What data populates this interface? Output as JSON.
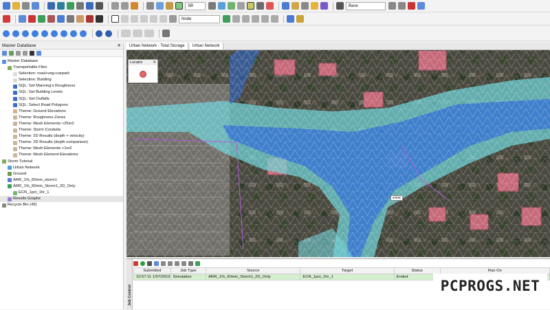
{
  "toolbar": {
    "combo_sb": "SB",
    "combo_base": "Base",
    "combo_node": "Node"
  },
  "left_panel": {
    "title": "Master Database",
    "tree": [
      {
        "label": "Master Database",
        "indent": 0,
        "icon": "database-icon"
      },
      {
        "label": "Transportable Files",
        "indent": 1,
        "icon": "group-icon"
      },
      {
        "label": "Selection: road+veg+carpark",
        "indent": 2,
        "icon": "selection-icon"
      },
      {
        "label": "Selection: Building",
        "indent": 2,
        "icon": "selection-icon"
      },
      {
        "label": "SQL: Set Manning's Roughness",
        "indent": 2,
        "icon": "sql-icon"
      },
      {
        "label": "SQL: Set Building Levels",
        "indent": 2,
        "icon": "sql-icon"
      },
      {
        "label": "SQL: Set Outfalls",
        "indent": 2,
        "icon": "sql-icon"
      },
      {
        "label": "SQL: Select Road Polygons",
        "indent": 2,
        "icon": "sql-icon"
      },
      {
        "label": "Theme: Ground Elevations",
        "indent": 2,
        "icon": "theme-icon"
      },
      {
        "label": "Theme: Roughness Zones",
        "indent": 2,
        "icon": "theme-icon"
      },
      {
        "label": "Theme: Mesh Elements <25m2",
        "indent": 2,
        "icon": "theme-icon"
      },
      {
        "label": "Theme: Storm Conduits",
        "indent": 2,
        "icon": "theme-icon"
      },
      {
        "label": "Theme: 2D Results (depth + velocity)",
        "indent": 2,
        "icon": "theme-icon"
      },
      {
        "label": "Theme: 2D Results (depth comparison)",
        "indent": 2,
        "icon": "theme-icon"
      },
      {
        "label": "Theme: Mesh Elements <1m2",
        "indent": 2,
        "icon": "theme-icon"
      },
      {
        "label": "Theme: Mesh Element Elevations",
        "indent": 2,
        "icon": "theme-icon"
      },
      {
        "label": "Storm Tutorial",
        "indent": 0,
        "icon": "group-icon"
      },
      {
        "label": "Urban Network",
        "indent": 1,
        "icon": "network-icon"
      },
      {
        "label": "Ground",
        "indent": 1,
        "icon": "ground-icon"
      },
      {
        "label": "ARR_1%_60min_storm1",
        "indent": 1,
        "icon": "rainfall-icon"
      },
      {
        "label": "ARR_1%_60min_Storm1_2D_Only",
        "indent": 1,
        "icon": "run-icon"
      },
      {
        "label": "ECN_1pct_1hr_1",
        "indent": 2,
        "icon": "simulation-icon"
      },
      {
        "label": "Results Graphs",
        "indent": 1,
        "icon": "graph-icon",
        "selected": true
      },
      {
        "label": "Recycle Bin (49)",
        "indent": 0,
        "icon": "recycle-bin-icon"
      }
    ]
  },
  "map": {
    "tab_label": "Urban Network - Total Storage",
    "tab_label_2": "Urban Network",
    "locator_title": "Locator",
    "tooltip": "zone"
  },
  "job_control": {
    "side_label": "Job Control",
    "columns": [
      "Submitted",
      "Job Type",
      "Source",
      "Target",
      "Status",
      "Run On"
    ],
    "rows": [
      {
        "submitted": "10:57:11 1/07/2019",
        "job_type": "Simulation",
        "source": "ARR_1%_60min_Storm1_2D_Only",
        "target": "ECN_1pct_1hr_1",
        "status": "Ended",
        "run_on": ""
      }
    ]
  },
  "watermark": "PCPROGS.NET",
  "colors": {
    "flood_deep": "#2f6bd8",
    "flood_shallow": "#6fd0d6",
    "job_row": "#d6efd1"
  }
}
